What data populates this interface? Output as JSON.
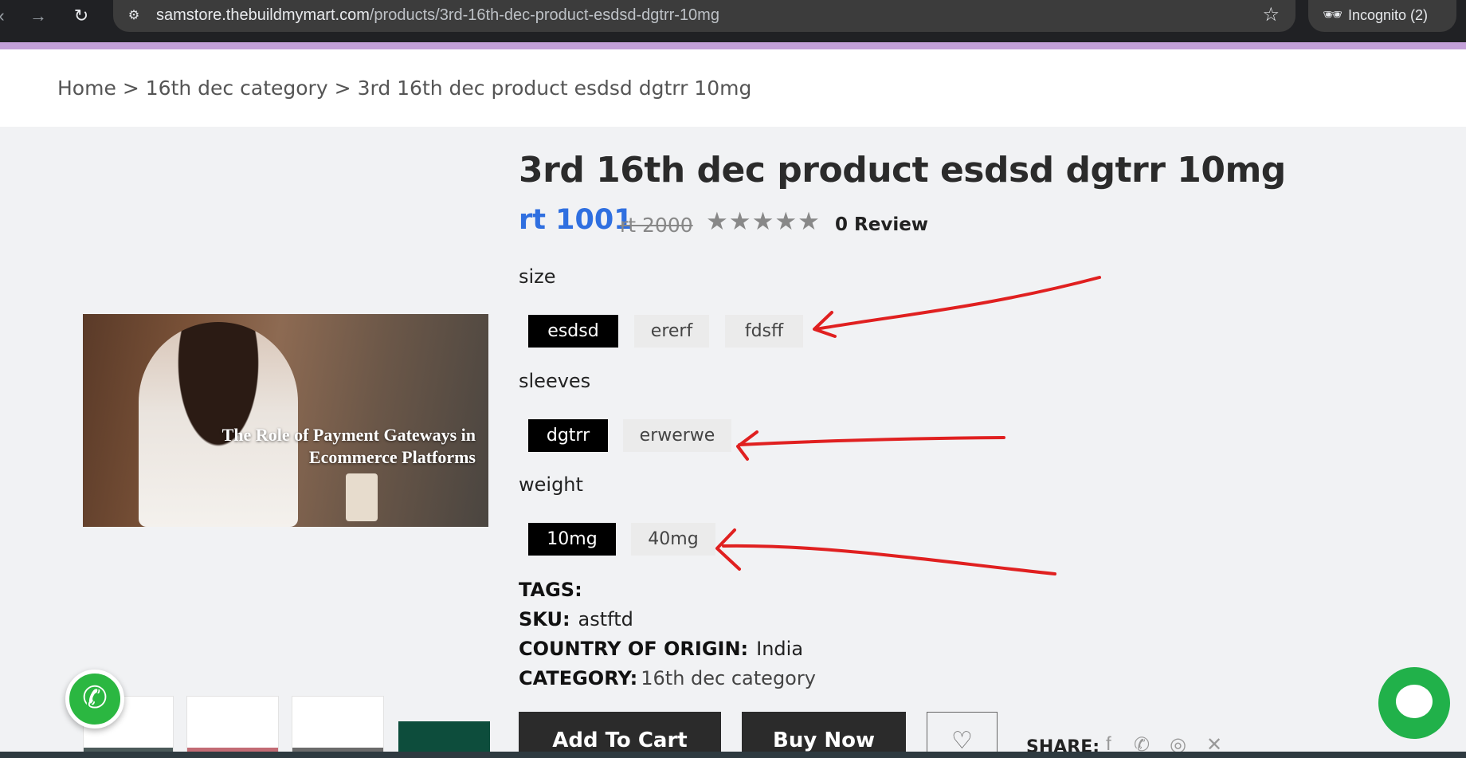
{
  "browser": {
    "url_host": "samstore.thebuildmymart.com",
    "url_path": "/products/3rd-16th-dec-product-esdsd-dgtrr-10mg",
    "incognito_label": "Incognito (2)"
  },
  "breadcrumb": {
    "home": "Home",
    "separator": ">",
    "category": "16th dec category",
    "current": "3rd 16th dec product esdsd dgtrr 10mg"
  },
  "image": {
    "caption_line1": "The Role of Payment Gateways in",
    "caption_line2": "Ecommerce Platforms"
  },
  "product": {
    "title": "3rd 16th dec product esdsd dgtrr 10mg",
    "price": "rt 1001",
    "old_price": "rt 2000",
    "rating_stars": "★★★★★",
    "rating": 0,
    "reviews": "0 Review"
  },
  "options": {
    "size": {
      "label": "size",
      "values": [
        "esdsd",
        "ererf",
        "fdsff"
      ],
      "selected": "esdsd"
    },
    "sleeves": {
      "label": "sleeves",
      "values": [
        "dgtrr",
        "erwerwe"
      ],
      "selected": "dgtrr"
    },
    "weight": {
      "label": "weight",
      "values": [
        "10mg",
        "40mg"
      ],
      "selected": "10mg"
    }
  },
  "meta": {
    "tags_label": "TAGS:",
    "sku_label": "SKU:",
    "sku": "astftd",
    "origin_label": "COUNTRY OF ORIGIN:",
    "origin": "India",
    "category_label": "CATEGORY:",
    "category": "16th dec category"
  },
  "actions": {
    "add_to_cart": "Add To Cart",
    "buy_now": "Buy Now",
    "share_label": "SHARE:"
  },
  "icons": {
    "wishlist": "heart-icon",
    "share": [
      "facebook-icon",
      "whatsapp-icon",
      "instagram-icon",
      "twitter-icon"
    ],
    "whatsapp_float": "whatsapp-icon",
    "chat": "chat-bubble-icon"
  },
  "colors": {
    "price": "#2f6fe0",
    "chip_selected": "#000000",
    "annotation": "#e02020",
    "whatsapp": "#2bb741",
    "chat": "#21b14a"
  }
}
